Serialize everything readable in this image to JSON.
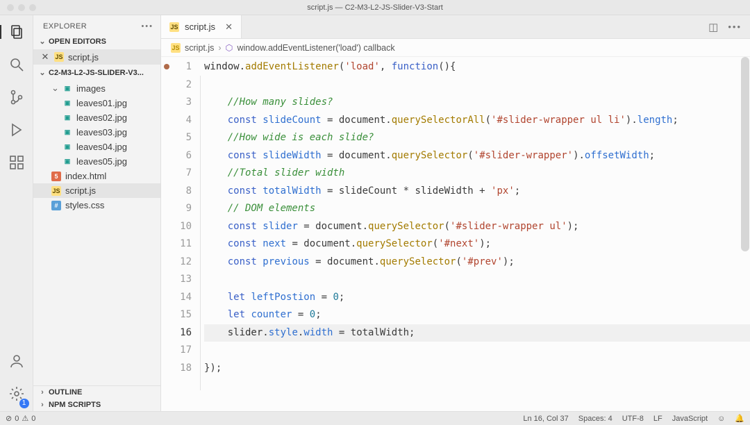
{
  "titlebar": "script.js — C2-M3-L2-JS-Slider-V3-Start",
  "sidebar": {
    "title": "EXPLORER",
    "openEditorsLabel": "OPEN EDITORS",
    "openEditors": [
      {
        "name": "script.js",
        "iconClass": "fi-js",
        "iconText": "JS"
      }
    ],
    "folderLabel": "C2-M3-L2-JS-SLIDER-V3...",
    "tree": [
      {
        "type": "folder",
        "name": "images",
        "expanded": true,
        "indent": 1,
        "children": [
          {
            "name": "leaves01.jpg"
          },
          {
            "name": "leaves02.jpg"
          },
          {
            "name": "leaves03.jpg"
          },
          {
            "name": "leaves04.jpg"
          },
          {
            "name": "leaves05.jpg"
          }
        ]
      },
      {
        "type": "file",
        "name": "index.html",
        "iconClass": "fi-html",
        "iconText": "5",
        "indent": 1
      },
      {
        "type": "file",
        "name": "script.js",
        "iconClass": "fi-js",
        "iconText": "JS",
        "indent": 1,
        "selected": true
      },
      {
        "type": "file",
        "name": "styles.css",
        "iconClass": "fi-css",
        "iconText": "#",
        "indent": 1
      }
    ],
    "outlineLabel": "OUTLINE",
    "npmLabel": "NPM SCRIPTS"
  },
  "tabs": {
    "active": {
      "name": "script.js"
    }
  },
  "breadcrumb": {
    "file": "script.js",
    "symbol": "window.addEventListener('load') callback"
  },
  "linesCount": 18,
  "highlightLine": 16,
  "settingsBadge": "1",
  "statusbar": {
    "errors": "0",
    "warnings": "0",
    "lncol": "Ln 16, Col 37",
    "spaces": "Spaces: 4",
    "encoding": "UTF-8",
    "eol": "LF",
    "language": "JavaScript"
  },
  "code": {
    "l1": {
      "a": "window.",
      "b": "addEventListener",
      "c": "(",
      "d": "'load'",
      "e": ", ",
      "f": "function",
      "g": "(){"
    },
    "l3": "//How many slides?",
    "l4": {
      "a": "const ",
      "b": "slideCount",
      "c": " = document.",
      "d": "querySelectorAll",
      "e": "(",
      "f": "'#slider-wrapper ul li'",
      "g": ").",
      "h": "length",
      "i": ";"
    },
    "l5": "//How wide is each slide?",
    "l6": {
      "a": "const ",
      "b": "slideWidth",
      "c": " = document.",
      "d": "querySelector",
      "e": "(",
      "f": "'#slider-wrapper'",
      "g": ").",
      "h": "offsetWidth",
      "i": ";"
    },
    "l7": "//Total slider width",
    "l8": {
      "a": "const ",
      "b": "totalWidth",
      "c": " = slideCount * slideWidth + ",
      "d": "'px'",
      "e": ";"
    },
    "l9": "// DOM elements",
    "l10": {
      "a": "const ",
      "b": "slider",
      "c": " = document.",
      "d": "querySelector",
      "e": "(",
      "f": "'#slider-wrapper ul'",
      "g": ");"
    },
    "l11": {
      "a": "const ",
      "b": "next",
      "c": " = document.",
      "d": "querySelector",
      "e": "(",
      "f": "'#next'",
      "g": ");"
    },
    "l12": {
      "a": "const ",
      "b": "previous",
      "c": " = document.",
      "d": "querySelector",
      "e": "(",
      "f": "'#prev'",
      "g": ");"
    },
    "l14": {
      "a": "let ",
      "b": "leftPostion",
      "c": " = ",
      "d": "0",
      "e": ";"
    },
    "l15": {
      "a": "let ",
      "b": "counter",
      "c": " = ",
      "d": "0",
      "e": ";"
    },
    "l16": {
      "a": "slider.",
      "b": "style",
      "c": ".",
      "d": "width",
      "e": " = totalWidth;"
    },
    "l18": "});"
  }
}
